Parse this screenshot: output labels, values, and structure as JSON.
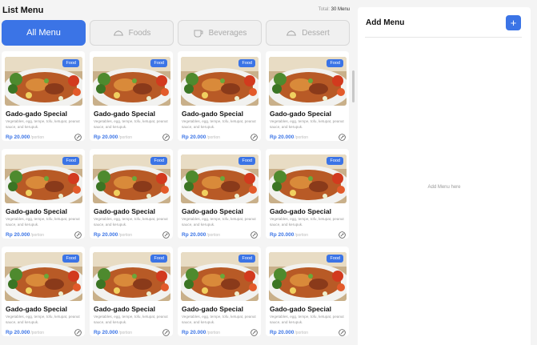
{
  "header": {
    "title": "List Menu",
    "total_label": "Total:",
    "total_value": "30 Menu"
  },
  "tabs": [
    {
      "label": "All Menu",
      "icon": "",
      "active": true
    },
    {
      "label": "Foods",
      "icon": "cloche-icon",
      "active": false
    },
    {
      "label": "Beverages",
      "icon": "cup-icon",
      "active": false
    },
    {
      "label": "Dessert",
      "icon": "cloche-icon",
      "active": false
    }
  ],
  "menu_items": [
    {
      "name": "Gado-gado Special",
      "description": "Vegetables, egg, tempe, tofu, ketupat, peanut sauce, and kerupuk.",
      "price": "Rp 20.000",
      "unit": "/portion",
      "badge": "Food"
    },
    {
      "name": "Gado-gado Special",
      "description": "Vegetables, egg, tempe, tofu, ketupat, peanut sauce, and kerupuk.",
      "price": "Rp 20.000",
      "unit": "/portion",
      "badge": "Food"
    },
    {
      "name": "Gado-gado Special",
      "description": "Vegetables, egg, tempe, tofu, ketupat, peanut sauce, and kerupuk.",
      "price": "Rp 20.000",
      "unit": "/portion",
      "badge": "Food"
    },
    {
      "name": "Gado-gado Special",
      "description": "Vegetables, egg, tempe, tofu, ketupat, peanut sauce, and kerupuk.",
      "price": "Rp 20.000",
      "unit": "/portion",
      "badge": "Food"
    },
    {
      "name": "Gado-gado Special",
      "description": "Vegetables, egg, tempe, tofu, ketupat, peanut sauce, and kerupuk.",
      "price": "Rp 20.000",
      "unit": "/portion",
      "badge": "Food"
    },
    {
      "name": "Gado-gado Special",
      "description": "Vegetables, egg, tempe, tofu, ketupat, peanut sauce, and kerupuk.",
      "price": "Rp 20.000",
      "unit": "/portion",
      "badge": "Food"
    },
    {
      "name": "Gado-gado Special",
      "description": "Vegetables, egg, tempe, tofu, ketupat, peanut sauce, and kerupuk.",
      "price": "Rp 20.000",
      "unit": "/portion",
      "badge": "Food"
    },
    {
      "name": "Gado-gado Special",
      "description": "Vegetables, egg, tempe, tofu, ketupat, peanut sauce, and kerupuk.",
      "price": "Rp 20.000",
      "unit": "/portion",
      "badge": "Food"
    },
    {
      "name": "Gado-gado Special",
      "description": "Vegetables, egg, tempe, tofu, ketupat, peanut sauce, and kerupuk.",
      "price": "Rp 20.000",
      "unit": "/portion",
      "badge": "Food"
    },
    {
      "name": "Gado-gado Special",
      "description": "Vegetables, egg, tempe, tofu, ketupat, peanut sauce, and kerupuk.",
      "price": "Rp 20.000",
      "unit": "/portion",
      "badge": "Food"
    },
    {
      "name": "Gado-gado Special",
      "description": "Vegetables, egg, tempe, tofu, ketupat, peanut sauce, and kerupuk.",
      "price": "Rp 20.000",
      "unit": "/portion",
      "badge": "Food"
    },
    {
      "name": "Gado-gado Special",
      "description": "Vegetables, egg, tempe, tofu, ketupat, peanut sauce, and kerupuk.",
      "price": "Rp 20.000",
      "unit": "/portion",
      "badge": "Food"
    }
  ],
  "add_panel": {
    "title": "Add Menu",
    "add_button_label": "+",
    "empty_text": "Add Menu here"
  },
  "colors": {
    "accent": "#3b74e6",
    "background": "#f4f4f4",
    "card": "#ffffff",
    "muted_text": "#999999"
  }
}
